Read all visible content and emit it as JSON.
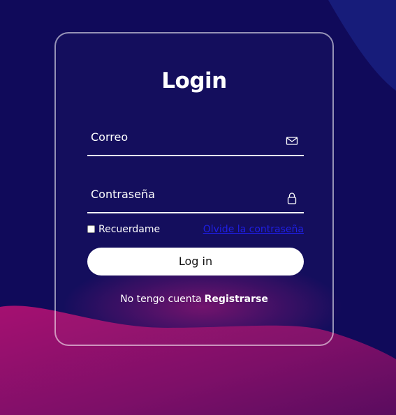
{
  "login": {
    "title": "Login",
    "email_label": "Correo",
    "password_label": "Contraseña",
    "remember_label": "Recuerdame",
    "forgot_link": "Olvide la contraseña",
    "login_button": "Log in",
    "no_account_text": "No tengo cuenta",
    "register_link": "Registrarse"
  },
  "icons": {
    "email": "envelope-icon",
    "password": "lock-icon"
  },
  "colors": {
    "background": "#100a5a",
    "wave": "#b01273",
    "link": "#1f1fe6",
    "button": "#ffffff"
  }
}
